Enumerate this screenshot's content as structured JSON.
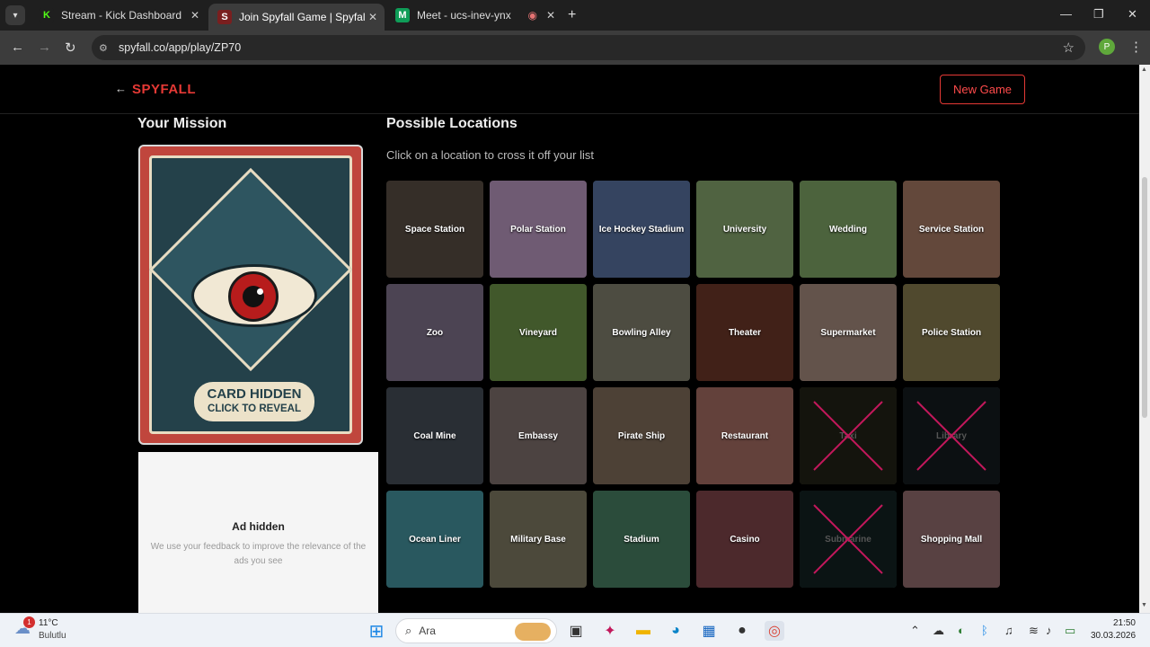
{
  "browser": {
    "tabs": [
      {
        "title": "Stream - Kick Dashboard",
        "favicon": "K",
        "active": false
      },
      {
        "title": "Join Spyfall Game | Spyfall Onli",
        "favicon": "S",
        "active": true
      },
      {
        "title": "Meet - ucs-inev-ynx",
        "favicon": "M",
        "active": false
      }
    ],
    "url": "spyfall.co/app/play/ZP70",
    "profile_initial": "P"
  },
  "header": {
    "brand": "SPYFALL",
    "new_game_label": "New Game"
  },
  "mission": {
    "title": "Your Mission",
    "card_line1": "CARD HIDDEN",
    "card_line2": "CLICK TO REVEAL"
  },
  "ad": {
    "title": "Ad hidden",
    "subtitle": "We use your feedback to improve the relevance of the ads you see"
  },
  "locations": {
    "title": "Possible Locations",
    "subtitle": "Click on a location to cross it off your list",
    "items": [
      {
        "name": "Space Station",
        "color": "#4a4038",
        "crossed": false
      },
      {
        "name": "Polar Station",
        "color": "#9a7fa0",
        "crossed": false
      },
      {
        "name": "Ice Hockey Stadium",
        "color": "#4a5f86",
        "crossed": false
      },
      {
        "name": "University",
        "color": "#6f8a5a",
        "crossed": false
      },
      {
        "name": "Wedding",
        "color": "#6a8a55",
        "crossed": false
      },
      {
        "name": "Service Station",
        "color": "#8a6452",
        "crossed": false
      },
      {
        "name": "Zoo",
        "color": "#6a5f73",
        "crossed": false
      },
      {
        "name": "Vineyard",
        "color": "#5a7a3c",
        "crossed": false
      },
      {
        "name": "Bowling Alley",
        "color": "#6b6a5a",
        "crossed": false
      },
      {
        "name": "Theater",
        "color": "#5a2e22",
        "crossed": false
      },
      {
        "name": "Supermarket",
        "color": "#8a7468",
        "crossed": false
      },
      {
        "name": "Police Station",
        "color": "#6f6640",
        "crossed": false
      },
      {
        "name": "Coal Mine",
        "color": "#3a4048",
        "crossed": false
      },
      {
        "name": "Embassy",
        "color": "#6a5e5a",
        "crossed": false
      },
      {
        "name": "Pirate Ship",
        "color": "#6b5a4c",
        "crossed": false
      },
      {
        "name": "Restaurant",
        "color": "#8a5a52",
        "crossed": false
      },
      {
        "name": "Taxi",
        "color": "#4a4a30",
        "crossed": true
      },
      {
        "name": "Library",
        "color": "#2e3c42",
        "crossed": true
      },
      {
        "name": "Ocean Liner",
        "color": "#3a7a84",
        "crossed": false
      },
      {
        "name": "Military Base",
        "color": "#6a6652",
        "crossed": false
      },
      {
        "name": "Stadium",
        "color": "#3c6a52",
        "crossed": false
      },
      {
        "name": "Casino",
        "color": "#6a3a3e",
        "crossed": false
      },
      {
        "name": "Submarine",
        "color": "#28484a",
        "crossed": true
      },
      {
        "name": "Shopping Mall",
        "color": "#7a5a5c",
        "crossed": false
      }
    ]
  },
  "taskbar": {
    "weather_badge": "1",
    "temperature": "11°C",
    "weather_desc": "Bulutlu",
    "search_label": "Ara",
    "time": "21:50",
    "date": "30.03.2026"
  }
}
